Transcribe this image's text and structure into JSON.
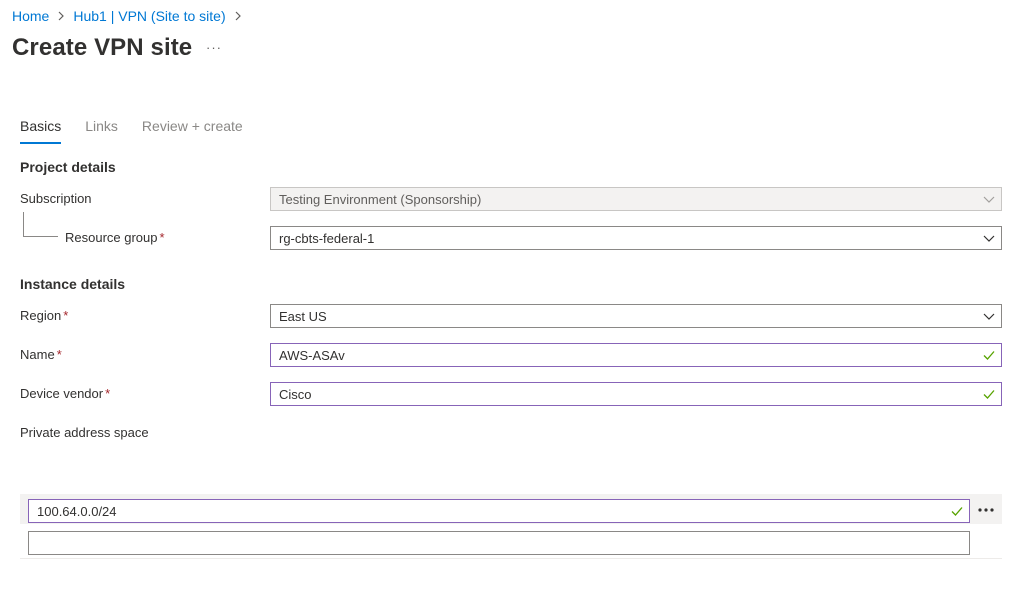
{
  "breadcrumb": {
    "home": "Home",
    "hub": "Hub1 | VPN (Site to site)"
  },
  "page": {
    "title": "Create VPN site",
    "more": "···"
  },
  "tabs": [
    {
      "label": "Basics"
    },
    {
      "label": "Links"
    },
    {
      "label": "Review + create"
    }
  ],
  "project": {
    "heading": "Project details",
    "subscription_label": "Subscription",
    "subscription_value": "Testing Environment (Sponsorship)",
    "rg_label": "Resource group",
    "rg_value": "rg-cbts-federal-1"
  },
  "instance": {
    "heading": "Instance details",
    "region_label": "Region",
    "region_value": "East US",
    "name_label": "Name",
    "name_value": "AWS-ASAv",
    "vendor_label": "Device vendor",
    "vendor_value": "Cisco",
    "address_label": "Private address space"
  },
  "address_space": {
    "rows": [
      "100.64.0.0/24",
      ""
    ]
  },
  "required_mark": "*",
  "colors": {
    "link": "#0078d4",
    "required": "#a4262c",
    "valid_border": "#8764b8",
    "valid_check": "#57a300"
  },
  "icons": {
    "breadcrumb_separator": "chevron-right-icon",
    "dropdown": "chevron-down-icon",
    "valid": "checkmark-icon",
    "row_menu": "more-icon"
  }
}
